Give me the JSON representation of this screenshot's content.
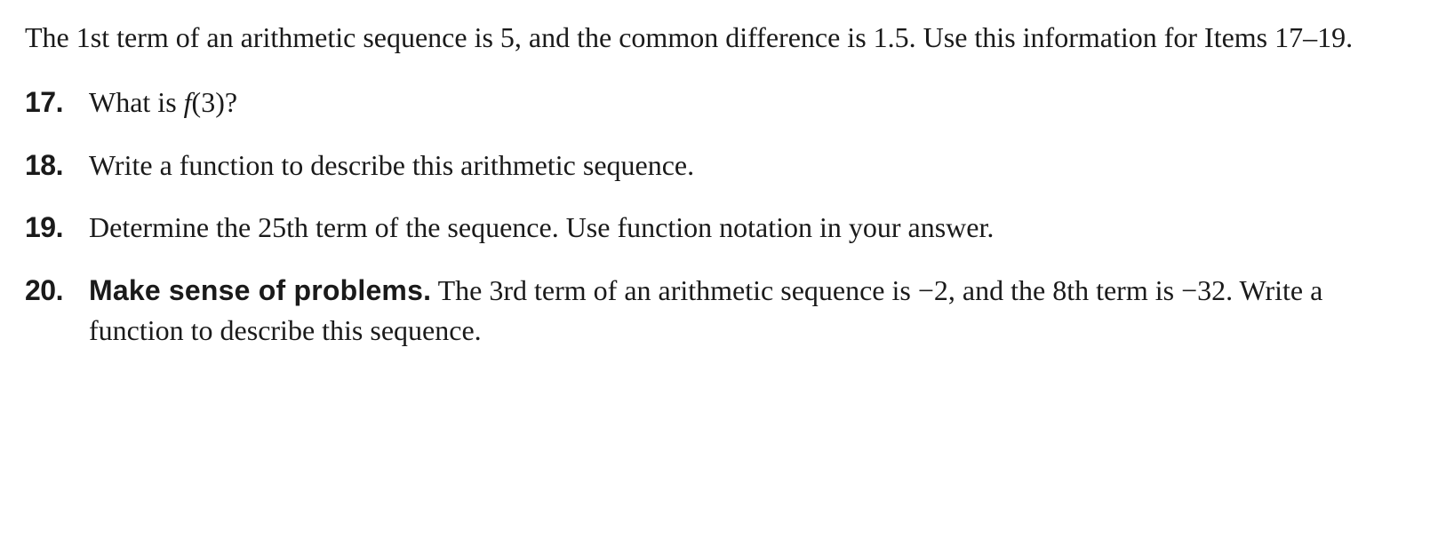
{
  "intro": {
    "text_part1": "The 1st term of an arithmetic sequence is 5, and the common difference is 1.5.",
    "text_part2": "Use this information for Items 17–19."
  },
  "problems": [
    {
      "number": "17.",
      "text_before": "What is ",
      "fn_letter": "f",
      "fn_arg": "(3)?"
    },
    {
      "number": "18.",
      "text": "Write a function to describe this arithmetic sequence."
    },
    {
      "number": "19.",
      "text": "Determine the 25th term of the sequence. Use function notation in your answer."
    },
    {
      "number": "20.",
      "bold_label": "Make sense of problems.",
      "text_after_bold_1": " The 3rd term of an arithmetic sequence is ",
      "neg1": "−2",
      "text_mid": ", and the 8th term is ",
      "neg2": "−32",
      "text_end": ". Write a function to describe this sequence."
    }
  ]
}
